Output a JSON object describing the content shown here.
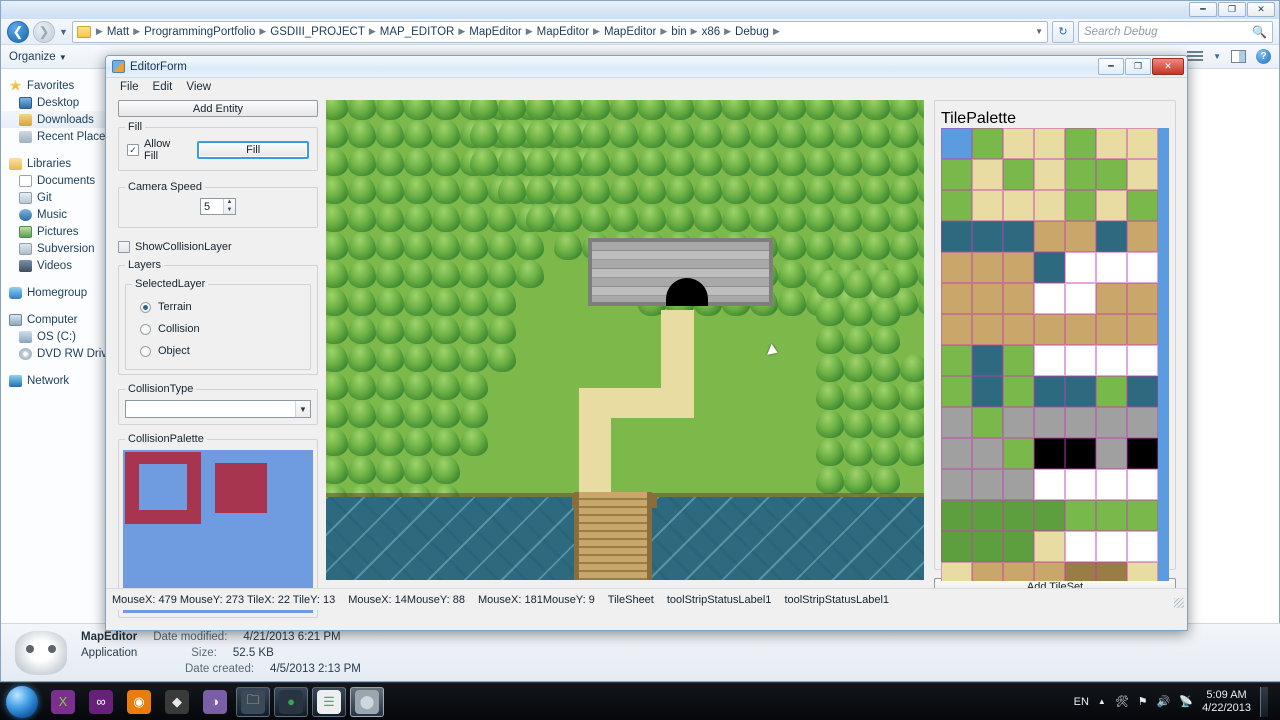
{
  "explorer": {
    "window_controls": [
      "minimize",
      "restore",
      "close"
    ],
    "breadcrumb": [
      "Matt",
      "ProgrammingPortfolio",
      "GSDIII_PROJECT",
      "MAP_EDITOR",
      "MapEditor",
      "MapEditor",
      "MapEditor",
      "bin",
      "x86",
      "Debug"
    ],
    "search_placeholder": "Search Debug",
    "toolbar": {
      "organize_label": "Organize"
    },
    "nav_pane": [
      {
        "label": "Favorites",
        "icon": "star-icon",
        "root": true
      },
      {
        "label": "Desktop",
        "icon": "desktop-icon",
        "root": false
      },
      {
        "label": "Downloads",
        "icon": "downloads-icon",
        "root": false,
        "selected": true
      },
      {
        "label": "Recent Places",
        "icon": "recent-places-icon",
        "root": false
      },
      {
        "label": "",
        "icon": "",
        "gap": true
      },
      {
        "label": "Libraries",
        "icon": "libraries-icon",
        "root": true
      },
      {
        "label": "Documents",
        "icon": "documents-icon",
        "root": false
      },
      {
        "label": "Git",
        "icon": "git-icon",
        "root": false
      },
      {
        "label": "Music",
        "icon": "music-icon",
        "root": false
      },
      {
        "label": "Pictures",
        "icon": "pictures-icon",
        "root": false
      },
      {
        "label": "Subversion",
        "icon": "subversion-icon",
        "root": false
      },
      {
        "label": "Videos",
        "icon": "videos-icon",
        "root": false
      },
      {
        "label": "",
        "icon": "",
        "gap": true
      },
      {
        "label": "Homegroup",
        "icon": "homegroup-icon",
        "root": true
      },
      {
        "label": "",
        "icon": "",
        "gap": true
      },
      {
        "label": "Computer",
        "icon": "computer-icon",
        "root": true
      },
      {
        "label": "OS (C:)",
        "icon": "drive-icon",
        "root": false
      },
      {
        "label": "DVD RW Drive",
        "icon": "dvd-drive-icon",
        "root": false
      },
      {
        "label": "",
        "icon": "",
        "gap": true
      },
      {
        "label": "Network",
        "icon": "network-icon",
        "root": true
      }
    ],
    "details": {
      "name": "MapEditor",
      "type": "Application",
      "date_modified_label": "Date modified:",
      "date_modified": "4/21/2013 6:21 PM",
      "size_label": "Size:",
      "size": "52.5 KB",
      "date_created_label": "Date created:",
      "date_created": "4/5/2013 2:13 PM"
    }
  },
  "editor": {
    "title": "EditorForm",
    "menu": [
      "File",
      "Edit",
      "View"
    ],
    "window_controls": [
      "minimize",
      "restore",
      "close"
    ],
    "add_entity_label": "Add Entity",
    "fill_group": {
      "title": "Fill",
      "allow_fill_label": "Allow Fill",
      "allow_fill_checked": true,
      "fill_button_label": "Fill"
    },
    "camera_speed": {
      "title": "Camera Speed",
      "value": "5"
    },
    "show_collision_layer": {
      "label": "ShowCollisionLayer",
      "checked": false
    },
    "layers_group": {
      "title": "Layers",
      "selected_layer_title": "SelectedLayer",
      "options": [
        {
          "label": "Terrain",
          "selected": true
        },
        {
          "label": "Collision",
          "selected": false
        },
        {
          "label": "Object",
          "selected": false
        }
      ]
    },
    "collision_type": {
      "title": "CollisionType",
      "value": ""
    },
    "collision_palette": {
      "title": "CollisionPalette",
      "background_color": "#6f9ce0",
      "shape_color": "#a83550"
    },
    "tile_palette": {
      "title": "TilePalette",
      "add_tileset_label": "Add TileSet",
      "grid_color": "#c23fb0"
    },
    "status_bar": [
      "MouseX: 479 MouseY: 273 TileX: 22 TileY: 13",
      "MouseX: 14MouseY: 88",
      "MouseX: 181MouseY: 9",
      "TileSheet",
      "toolStripStatusLabel1",
      "toolStripStatusLabel1"
    ]
  },
  "taskbar": {
    "start_label": "start-orb",
    "items": [
      {
        "name": "xamarin-icon",
        "glyph": "X",
        "color": "#8dc63f",
        "bg": "#7b2f8f",
        "state": "pinned"
      },
      {
        "name": "visual-studio-icon",
        "glyph": "∞",
        "color": "#ffffff",
        "bg": "#68217a",
        "state": "pinned"
      },
      {
        "name": "blender-icon",
        "glyph": "◉",
        "color": "#ffffff",
        "bg": "#e87d0d",
        "state": "pinned"
      },
      {
        "name": "unity-icon",
        "glyph": "◆",
        "color": "#e8e8e8",
        "bg": "#3a3a3a",
        "state": "pinned"
      },
      {
        "name": "sublime-icon",
        "glyph": "◑",
        "color": "#f2f2f2",
        "bg": "#7a5fa8",
        "state": "pinned"
      },
      {
        "name": "explorer-icon",
        "glyph": "🗀",
        "color": "#f6d98a",
        "bg": "#3b4a58",
        "state": "open"
      },
      {
        "name": "chrome-icon",
        "glyph": "●",
        "color": "#34a853",
        "bg": "#2a3340",
        "state": "open"
      },
      {
        "name": "notepad-icon",
        "glyph": "☰",
        "color": "#4caf50",
        "bg": "#eceff1",
        "state": "open"
      },
      {
        "name": "mapeditor-icon",
        "glyph": "⬤",
        "color": "#cfd6dc",
        "bg": "#9aa6b0",
        "state": "active"
      }
    ],
    "tray": {
      "language": "EN",
      "time": "5:09 AM",
      "date": "4/22/2013"
    }
  }
}
